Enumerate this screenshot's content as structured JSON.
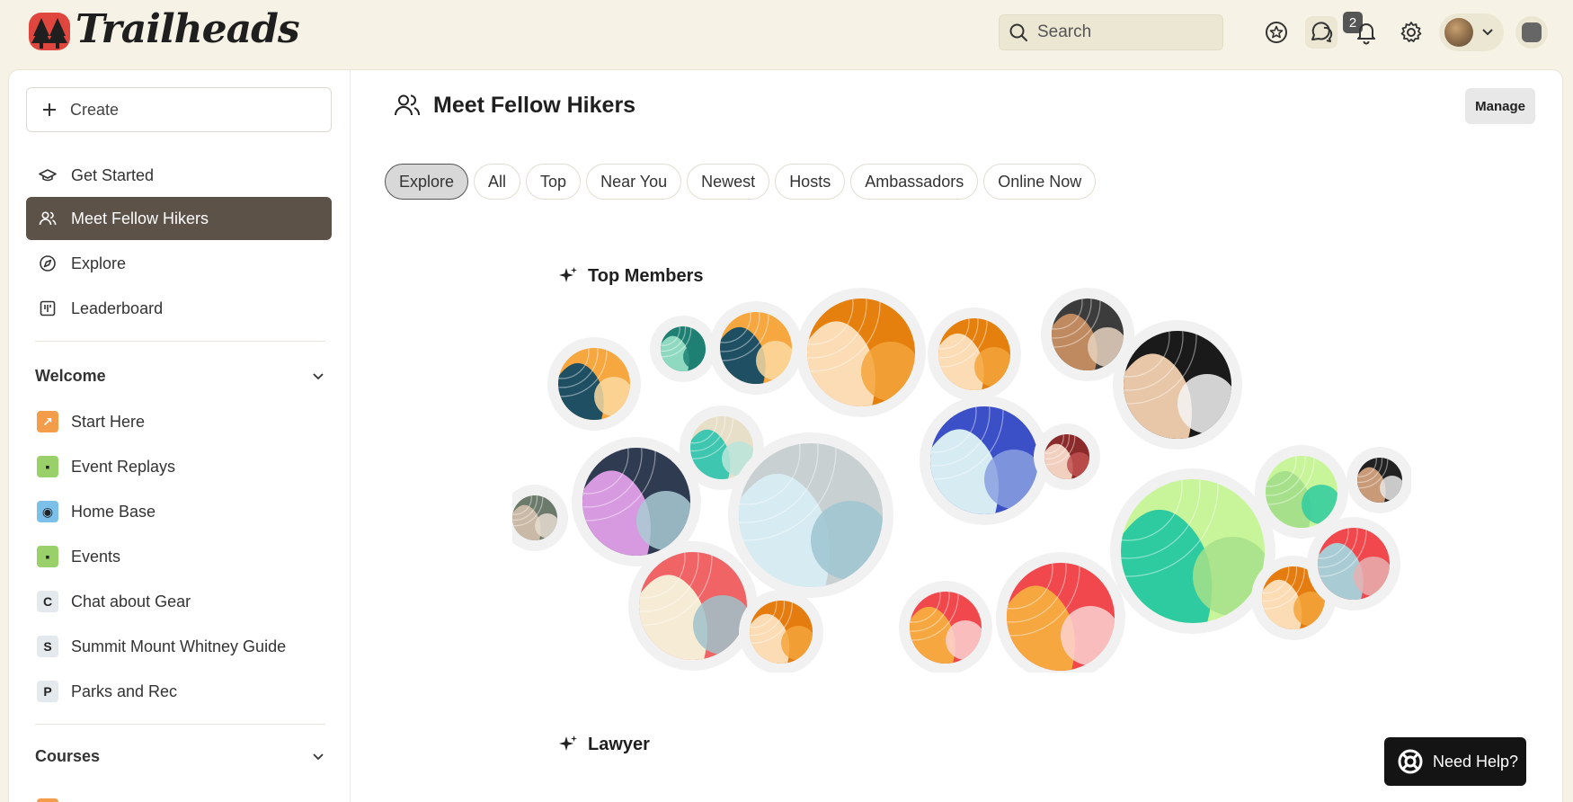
{
  "brand": {
    "name": "Trailheads"
  },
  "header": {
    "search_placeholder": "Search",
    "messages_badge": "2"
  },
  "sidebar": {
    "create_label": "Create",
    "nav": [
      {
        "label": "Get Started",
        "icon": "graduation-cap-icon"
      },
      {
        "label": "Meet Fellow Hikers",
        "icon": "users-icon"
      },
      {
        "label": "Explore",
        "icon": "compass-icon"
      },
      {
        "label": "Leaderboard",
        "icon": "leaderboard-icon"
      }
    ],
    "welcome": {
      "title": "Welcome",
      "spaces": [
        {
          "label": "Start Here",
          "icon": "arrow-icon",
          "color": "#f39c4a",
          "glyph": "↗"
        },
        {
          "label": "Event Replays",
          "icon": "calendar-icon",
          "color": "#9ad06a",
          "glyph": "▪"
        },
        {
          "label": "Home Base",
          "icon": "compass-icon",
          "color": "#7cc0ea",
          "glyph": "◉"
        },
        {
          "label": "Events",
          "icon": "calendar-icon",
          "color": "#9ad06a",
          "glyph": "▪"
        },
        {
          "label": "Chat about Gear",
          "icon": "letter-c-icon",
          "color": "#e4e9ee",
          "glyph": "C"
        },
        {
          "label": "Summit Mount Whitney Guide",
          "icon": "letter-s-icon",
          "color": "#e4e9ee",
          "glyph": "S"
        },
        {
          "label": "Parks and Rec",
          "icon": "letter-p-icon",
          "color": "#e4e9ee",
          "glyph": "P"
        }
      ]
    },
    "courses": {
      "title": "Courses"
    }
  },
  "main": {
    "title": "Meet Fellow Hikers",
    "manage_label": "Manage",
    "tabs": [
      "Explore",
      "All",
      "Top",
      "Near You",
      "Newest",
      "Hosts",
      "Ambassadors",
      "Online Now"
    ],
    "active_tab": "Explore",
    "sections": [
      {
        "title": "Top Members"
      },
      {
        "title": "Lawyer"
      }
    ]
  },
  "help": {
    "label": "Need Help?"
  },
  "colors": {
    "accent_dark": "#5c5248",
    "background": "#f6f3e6",
    "logo_red": "#e0463e"
  }
}
